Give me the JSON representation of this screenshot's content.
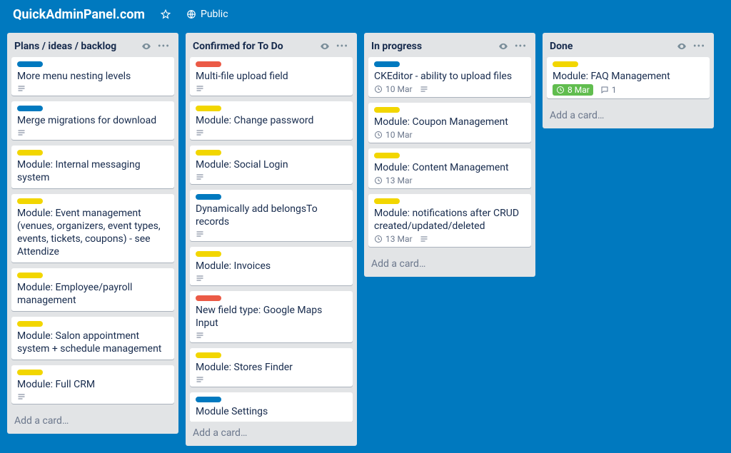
{
  "header": {
    "board_title": "QuickAdminPanel.com",
    "public_label": "Public"
  },
  "common": {
    "add_card": "Add a card…"
  },
  "lists": [
    {
      "title": "Plans / ideas / backlog",
      "cards": [
        {
          "labels": [
            "blue"
          ],
          "title": "More menu nesting levels",
          "desc": true
        },
        {
          "labels": [
            "blue"
          ],
          "title": "Merge migrations for download",
          "desc": true
        },
        {
          "labels": [
            "yellow"
          ],
          "title": "Module: Internal messaging system"
        },
        {
          "labels": [
            "yellow"
          ],
          "title": "Module: Event management (venues, organizers, event types, events, tickets, coupons) - see Attendize"
        },
        {
          "labels": [
            "yellow"
          ],
          "title": "Module: Employee/payroll management"
        },
        {
          "labels": [
            "yellow"
          ],
          "title": "Module: Salon appointment system + schedule management"
        },
        {
          "labels": [
            "yellow"
          ],
          "title": "Module: Full CRM",
          "desc": true
        }
      ]
    },
    {
      "title": "Confirmed for To Do",
      "cards": [
        {
          "labels": [
            "red"
          ],
          "title": "Multi-file upload field",
          "desc": true
        },
        {
          "labels": [
            "yellow"
          ],
          "title": "Module: Change password",
          "desc": true
        },
        {
          "labels": [
            "yellow"
          ],
          "title": "Module: Social Login",
          "desc": true
        },
        {
          "labels": [
            "blue"
          ],
          "title": "Dynamically add belongsTo records",
          "desc": true
        },
        {
          "labels": [
            "yellow"
          ],
          "title": "Module: Invoices",
          "desc": true
        },
        {
          "labels": [
            "red"
          ],
          "title": "New field type: Google Maps Input",
          "desc": true
        },
        {
          "labels": [
            "yellow"
          ],
          "title": "Module: Stores Finder",
          "desc": true
        },
        {
          "labels": [
            "blue"
          ],
          "title": "Module Settings"
        }
      ]
    },
    {
      "title": "In progress",
      "cards": [
        {
          "labels": [
            "blue"
          ],
          "title": "CKEditor - ability to upload files",
          "due": "10 Mar",
          "desc": true
        },
        {
          "labels": [
            "yellow"
          ],
          "title": "Module: Coupon Management",
          "due": "10 Mar"
        },
        {
          "labels": [
            "yellow"
          ],
          "title": "Module: Content Management",
          "due": "13 Mar"
        },
        {
          "labels": [
            "yellow"
          ],
          "title": "Module: notifications after CRUD created/updated/deleted",
          "due": "13 Mar",
          "desc": true
        }
      ]
    },
    {
      "title": "Done",
      "cards": [
        {
          "labels": [
            "yellow"
          ],
          "title": "Module: FAQ Management",
          "due": "8 Mar",
          "due_done": true,
          "comments": 1
        }
      ]
    }
  ]
}
